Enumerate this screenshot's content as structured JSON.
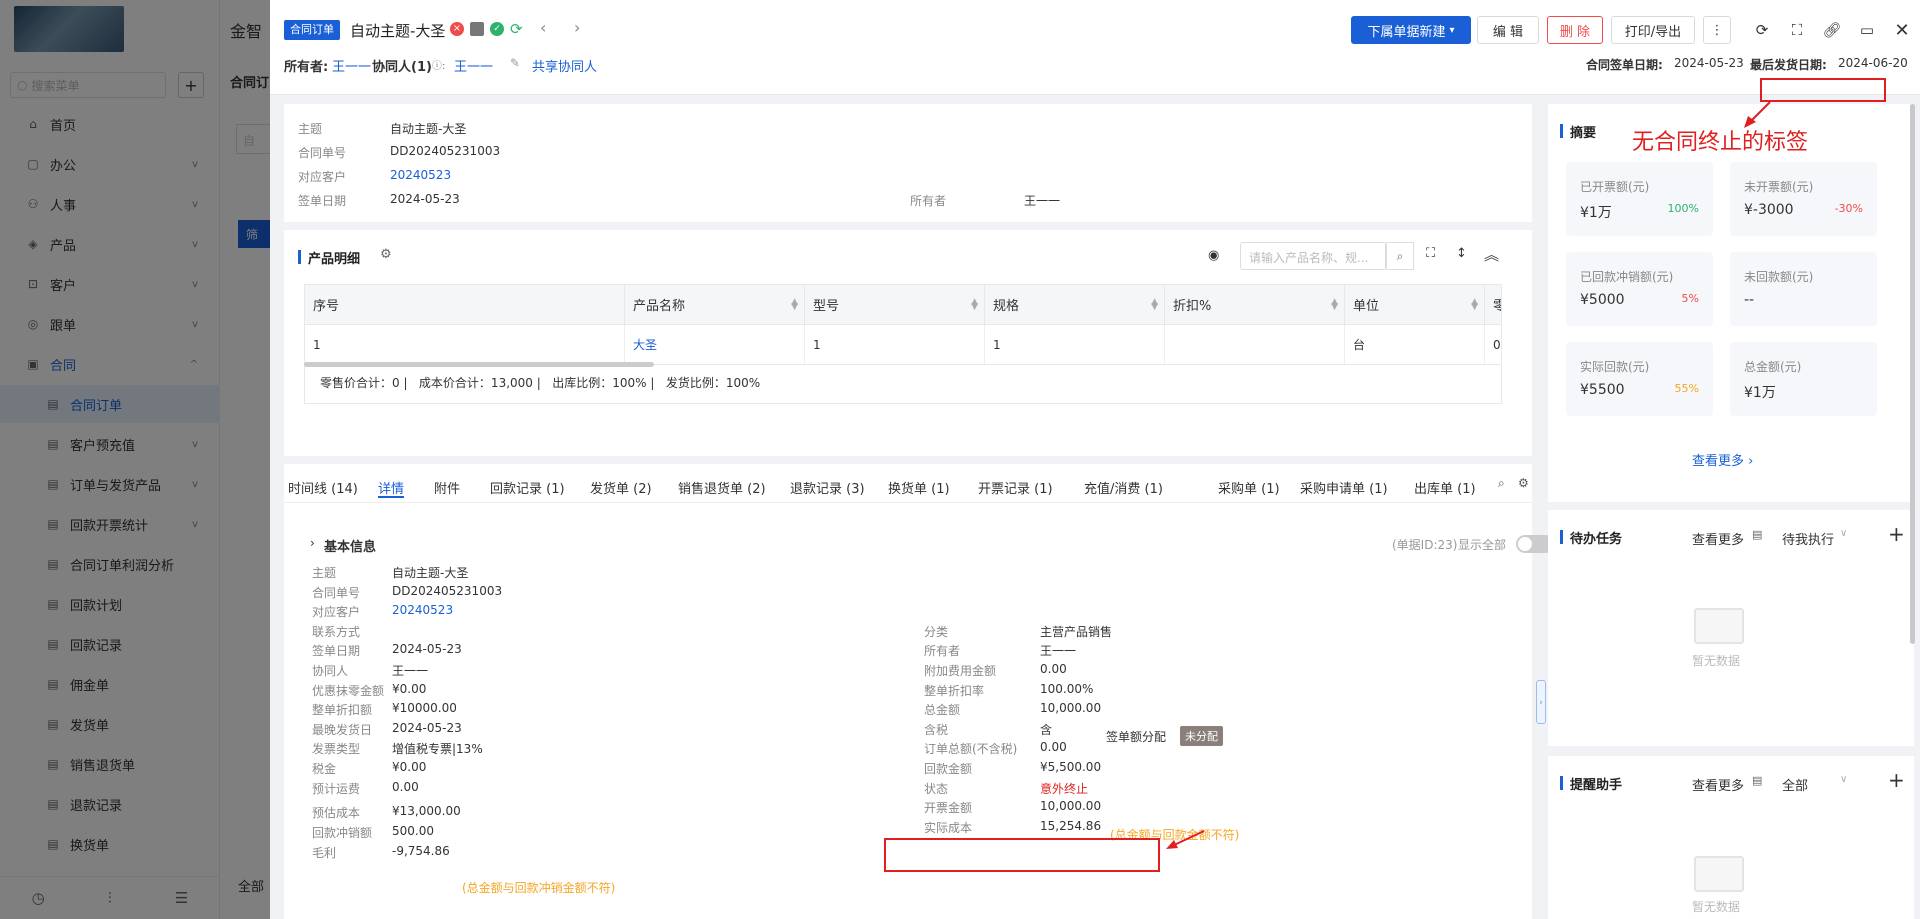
{
  "sidebar": {
    "search_placeholder": "搜索菜单",
    "items": [
      {
        "label": "首页",
        "icon": "home-icon"
      },
      {
        "label": "办公",
        "icon": "office-icon"
      },
      {
        "label": "人事",
        "icon": "person-icon"
      },
      {
        "label": "产品",
        "icon": "box-icon"
      },
      {
        "label": "客户",
        "icon": "customer-icon"
      },
      {
        "label": "跟单",
        "icon": "follow-icon"
      },
      {
        "label": "合同",
        "icon": "contract-icon"
      }
    ],
    "sub_items": [
      "合同订单",
      "客户预充值",
      "订单与发货产品",
      "回款开票统计",
      "合同订单利润分析",
      "回款计划",
      "回款记录",
      "佣金单",
      "发货单",
      "销售退货单",
      "退款记录",
      "换货单"
    ]
  },
  "behind": {
    "brand": "金智",
    "tab": "合同订",
    "filter": "筛",
    "label2": "全部",
    "search": "自"
  },
  "header": {
    "badge": "合同订单",
    "title": "自动主题-大圣",
    "owner_label": "所有者:",
    "owner": "王一一",
    "collab_label": "协同人(1)",
    "collab": "王一一",
    "share": "共享协同人",
    "new_btn": "下属单据新建",
    "edit_btn": "编 辑",
    "delete_btn": "删 除",
    "print_btn": "打印/导出",
    "sign_date_label": "合同签单日期:",
    "sign_date": "2024-05-23",
    "ship_date_label": "最后发货日期:",
    "ship_date": "2024-06-20"
  },
  "annotation": {
    "text": "无合同终止的标签"
  },
  "summary": {
    "labels": [
      "主题",
      "合同单号",
      "对应客户",
      "签单日期"
    ],
    "values": [
      "自动主题-大圣",
      "DD202405231003",
      "20240523",
      "2024-05-23"
    ],
    "owner_label": "所有者",
    "owner": "王一一"
  },
  "products": {
    "title": "产品明细",
    "search_placeholder": "请输入产品名称、规...",
    "headers": [
      "序号",
      "产品名称",
      "型号",
      "规格",
      "折扣%",
      "单位",
      "零"
    ],
    "row": [
      "1",
      "大圣",
      "1",
      "1",
      "",
      "台",
      "0"
    ],
    "footer": "零售价合计：0 |   成本价合计：13,000 |   出库比例：100% |   发货比例：100%"
  },
  "tabs": [
    "时间线 (14)",
    "详情",
    "附件",
    "回款记录 (1)",
    "发货单 (2)",
    "销售退货单 (2)",
    "退款记录 (3)",
    "换货单 (1)",
    "开票记录 (1)",
    "充值/消费 (1)",
    "采购单 (1)",
    "采购申请单 (1)",
    "出库单 (1)"
  ],
  "detail": {
    "section": "基本信息",
    "doc_id": "(单据ID:23)",
    "show_all": "显示全部",
    "left": [
      {
        "k": "主题",
        "v": "自动主题-大圣"
      },
      {
        "k": "合同单号",
        "v": "DD202405231003"
      },
      {
        "k": "对应客户",
        "v": "20240523"
      },
      {
        "k": "联系方式",
        "v": ""
      },
      {
        "k": "签单日期",
        "v": "2024-05-23"
      },
      {
        "k": "协同人",
        "v": "王一一"
      },
      {
        "k": "优惠抹零金额",
        "v": "¥0.00"
      },
      {
        "k": "整单折扣额",
        "v": "¥10000.00"
      },
      {
        "k": "最晚发货日",
        "v": "2024-05-23"
      },
      {
        "k": "发票类型",
        "v": "增值税专票|13%"
      },
      {
        "k": "税金",
        "v": "¥0.00"
      },
      {
        "k": "预计运费",
        "v": "0.00"
      },
      {
        "k": "预估成本",
        "v": "¥13,000.00"
      },
      {
        "k": "回款冲销额",
        "v": "500.00"
      },
      {
        "k": "毛利",
        "v": "-9,754.86"
      }
    ],
    "left_warn": "(总金额与回款冲销金额不符)",
    "right": [
      {
        "k": "分类",
        "v": "主营产品销售"
      },
      {
        "k": "所有者",
        "v": "王一一"
      },
      {
        "k": "附加费用金额",
        "v": "0.00"
      },
      {
        "k": "整单折扣率",
        "v": "100.00%"
      },
      {
        "k": "总金额",
        "v": "10,000.00"
      },
      {
        "k": "含税",
        "v": "含"
      },
      {
        "k": "订单总额(不含税)",
        "v": "0.00"
      },
      {
        "k": "回款金额",
        "v": "¥5,500.00"
      },
      {
        "k": "状态",
        "v": "意外终止"
      },
      {
        "k": "开票金额",
        "v": "10,000.00"
      },
      {
        "k": "实际成本",
        "v": "15,254.86"
      }
    ],
    "alloc_label": "签单额分配",
    "alloc_badge": "未分配",
    "right_warn": "(总金额与回款金额不符)"
  },
  "abstract": {
    "title": "摘要",
    "stats": [
      {
        "t": "已开票额(元)",
        "v": "¥1万",
        "p": "100%",
        "c": "#2db36a"
      },
      {
        "t": "未开票额(元)",
        "v": "¥-3000",
        "p": "-30%",
        "c": "#f04a4a"
      },
      {
        "t": "已回款冲销额(元)",
        "v": "¥5000",
        "p": "5%",
        "c": "#f04a4a"
      },
      {
        "t": "未回款额(元)",
        "v": "--",
        "p": "",
        "c": "#333"
      },
      {
        "t": "实际回款(元)",
        "v": "¥5500",
        "p": "55%",
        "c": "#f5a623"
      },
      {
        "t": "总金额(元)",
        "v": "¥1万",
        "p": "",
        "c": "#333"
      }
    ],
    "more": "查看更多"
  },
  "todo": {
    "title": "待办任务",
    "more": "查看更多",
    "filter": "待我执行",
    "empty": "暂无数据"
  },
  "reminder": {
    "title": "提醒助手",
    "more": "查看更多",
    "filter": "全部",
    "empty": "暂无数据"
  }
}
